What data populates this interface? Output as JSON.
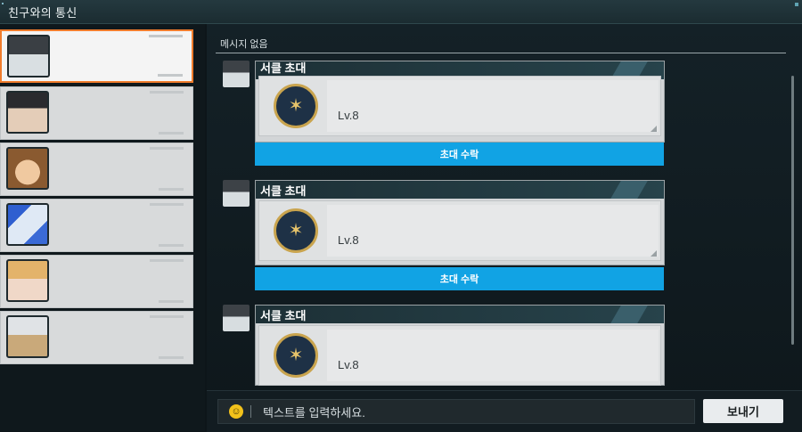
{
  "window": {
    "title": "친구와의 통신"
  },
  "colors": {
    "accent_blue": "#11a3e4",
    "selected_border": "#f07c2c",
    "emblem_gold": "#c9a44e"
  },
  "friends": [
    {
      "avatar": "avatar-helmet-girl",
      "selected": true
    },
    {
      "avatar": "avatar-dark-hair-boy",
      "selected": false
    },
    {
      "avatar": "avatar-brown-hair-girl",
      "selected": false
    },
    {
      "avatar": "avatar-blue-hair-girl",
      "selected": false
    },
    {
      "avatar": "avatar-blonde-girl",
      "selected": false
    },
    {
      "avatar": "avatar-white-hair-girl",
      "selected": false
    }
  ],
  "chat": {
    "empty_label": "메시지 없음",
    "messages": [
      {
        "title": "서클 초대",
        "level": "Lv.8",
        "button": "초대 수락",
        "emblem": "circle-emblem-icon"
      },
      {
        "title": "서클 초대",
        "level": "Lv.8",
        "button": "초대 수락",
        "emblem": "circle-emblem-icon"
      },
      {
        "title": "서클 초대",
        "level": "Lv.8",
        "button": "",
        "emblem": "circle-emblem-icon"
      }
    ]
  },
  "composer": {
    "placeholder": "텍스트를 입력하세요.",
    "emoji_icon": "smiley-icon",
    "send_label": "보내기"
  }
}
